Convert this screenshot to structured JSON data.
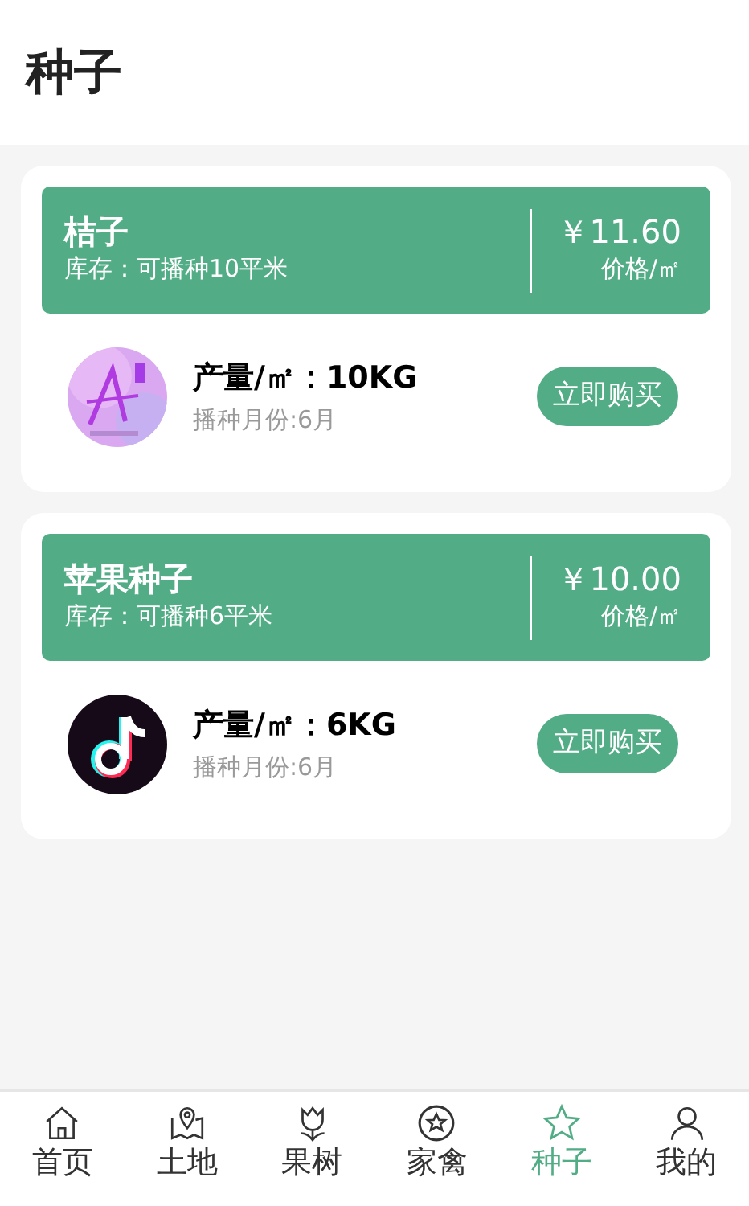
{
  "header": {
    "title": "种子"
  },
  "products": [
    {
      "name": "桔子",
      "stock": "库存：可播种10平米",
      "price": "￥11.60",
      "price_unit": "价格/㎡",
      "yield": "产量/㎡：10KG",
      "sowing": "播种月份:6月",
      "button": "立即购买"
    },
    {
      "name": "苹果种子",
      "stock": "库存：可播种6平米",
      "price": "￥10.00",
      "price_unit": "价格/㎡",
      "yield": "产量/㎡：6KG",
      "sowing": "播种月份:6月",
      "button": "立即购买"
    }
  ],
  "tabbar": [
    {
      "label": "首页",
      "selected": false
    },
    {
      "label": "土地",
      "selected": false
    },
    {
      "label": "果树",
      "selected": false
    },
    {
      "label": "家禽",
      "selected": false
    },
    {
      "label": "种子",
      "selected": true
    },
    {
      "label": "我的",
      "selected": false
    }
  ]
}
